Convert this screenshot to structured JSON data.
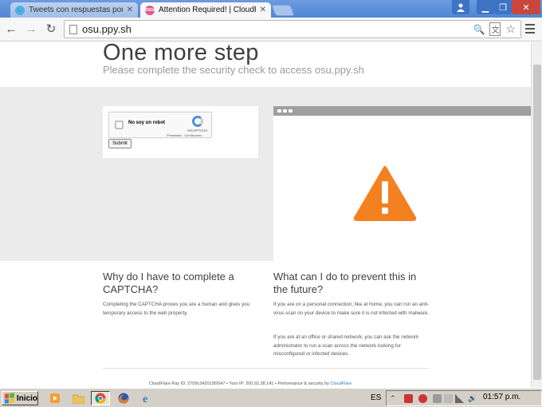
{
  "browser": {
    "tabs": [
      {
        "title": "Tweets con respuestas por C",
        "active": false
      },
      {
        "title": "Attention Required! | CloudFl",
        "active": true
      }
    ],
    "url": "osu.ppy.sh"
  },
  "page": {
    "heading": "One more step",
    "subheading": "Please complete the security check to access osu.ppy.sh",
    "captcha": {
      "label": "No soy un robot",
      "brand": "reCAPTCHA",
      "links": "Privacidad · Condiciones",
      "submit_label": "Submit"
    },
    "why": {
      "title": "Why do I have to complete a CAPTCHA?",
      "text": "Completing the CAPTCHA proves you are a human and gives you temporary access to the web property."
    },
    "prevent": {
      "title": "What can I do to prevent this in the future?",
      "text1": "If you are on a personal connection, like at home, you can run an anti-virus scan on your device to make sure it is not infected with malware.",
      "text2": "If you are at an office or shared network, you can ask the network administrator to run a scan across the network looking for misconfigured or infected devices."
    },
    "footer": {
      "ray": "CloudFlare Ray ID: 2709c342019f2647",
      "ip": "Your IP: 200.92.38.141",
      "perf": "Performance & security by",
      "link": "CloudFlare"
    }
  },
  "taskbar": {
    "start_label": "Inicio",
    "language": "ES",
    "time": "01:57 p.m."
  },
  "colors": {
    "tab_strip": "#4f86d2",
    "warning": "#f48120",
    "link": "#2f7bbf",
    "taskbar": "#d4d0c8"
  },
  "icons": [
    "twitter-icon",
    "osu-icon",
    "back-icon",
    "forward-icon",
    "reload-icon",
    "page-icon",
    "zoom-icon",
    "translate-icon",
    "star-icon",
    "menu-icon",
    "warning-icon",
    "recaptcha-icon",
    "windows-logo-icon",
    "media-player-icon",
    "folder-icon",
    "chrome-icon",
    "firefox-icon",
    "ie-icon"
  ]
}
